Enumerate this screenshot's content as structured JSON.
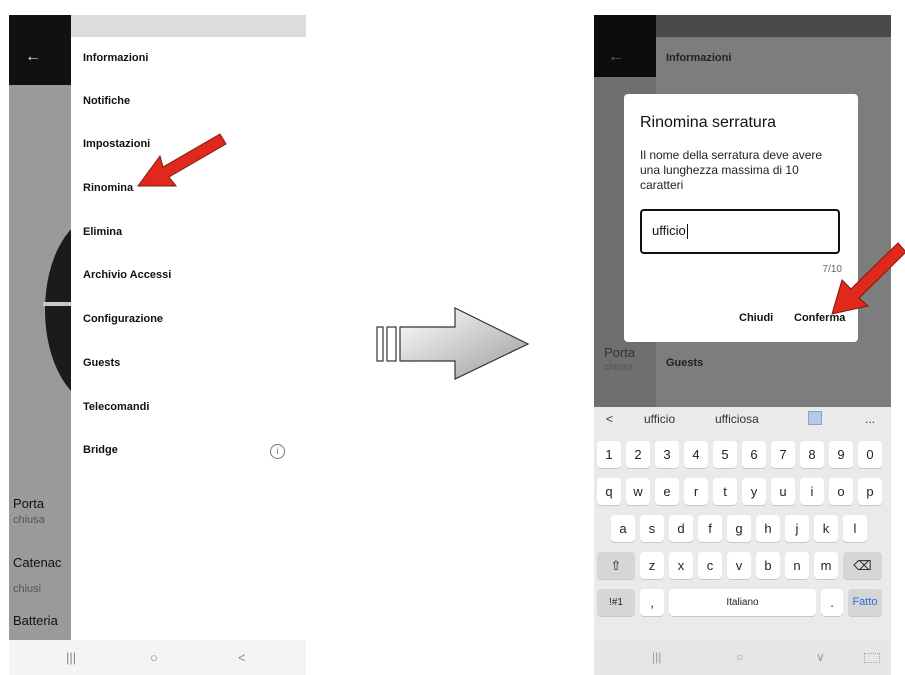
{
  "left": {
    "menu": [
      {
        "label": "Informazioni"
      },
      {
        "label": "Notifiche"
      },
      {
        "label": "Impostazioni"
      },
      {
        "label": "Rinomina"
      },
      {
        "label": "Elimina"
      },
      {
        "label": "Archivio Accessi"
      },
      {
        "label": "Configurazione"
      },
      {
        "label": "Guests"
      },
      {
        "label": "Telecomandi"
      },
      {
        "label": "Bridge"
      }
    ],
    "background": {
      "porta": "Porta",
      "porta_status": "chiusa",
      "catenacci": "Catenac",
      "catenacci_status": "chiusi",
      "batteria": "Batteria"
    },
    "nav": {
      "recents": "|||",
      "home": "○",
      "back": "<"
    }
  },
  "right": {
    "bg": {
      "informazioni": "Informazioni",
      "guests": "Guests",
      "porta": "Porta",
      "porta_status": "chiusa"
    },
    "dialog": {
      "title": "Rinomina serratura",
      "message": "Il nome della serratura deve avere una lunghezza massima di 10 caratteri",
      "input_value": "ufficio",
      "counter": "7/10",
      "close_label": "Chiudi",
      "confirm_label": "Conferma"
    },
    "keyboard": {
      "suggest": {
        "back": "<",
        "s1": "ufficio",
        "s2": "ufficiosa",
        "more": "..."
      },
      "row_numbers": [
        "1",
        "2",
        "3",
        "4",
        "5",
        "6",
        "7",
        "8",
        "9",
        "0"
      ],
      "row_top": [
        "q",
        "w",
        "e",
        "r",
        "t",
        "y",
        "u",
        "i",
        "o",
        "p"
      ],
      "row_mid": [
        "a",
        "s",
        "d",
        "f",
        "g",
        "h",
        "j",
        "k",
        "l"
      ],
      "row_bottom": [
        "z",
        "x",
        "c",
        "v",
        "b",
        "n",
        "m"
      ],
      "symbols": "!#1",
      "comma": ",",
      "space": "Italiano",
      "period": ".",
      "done": "Fatto"
    },
    "nav": {
      "recents": "|||",
      "home": "○",
      "hide": "∨"
    }
  },
  "colors": {
    "annotation_arrow": "#e0291c",
    "keyboard_done": "#2a6fd6"
  }
}
